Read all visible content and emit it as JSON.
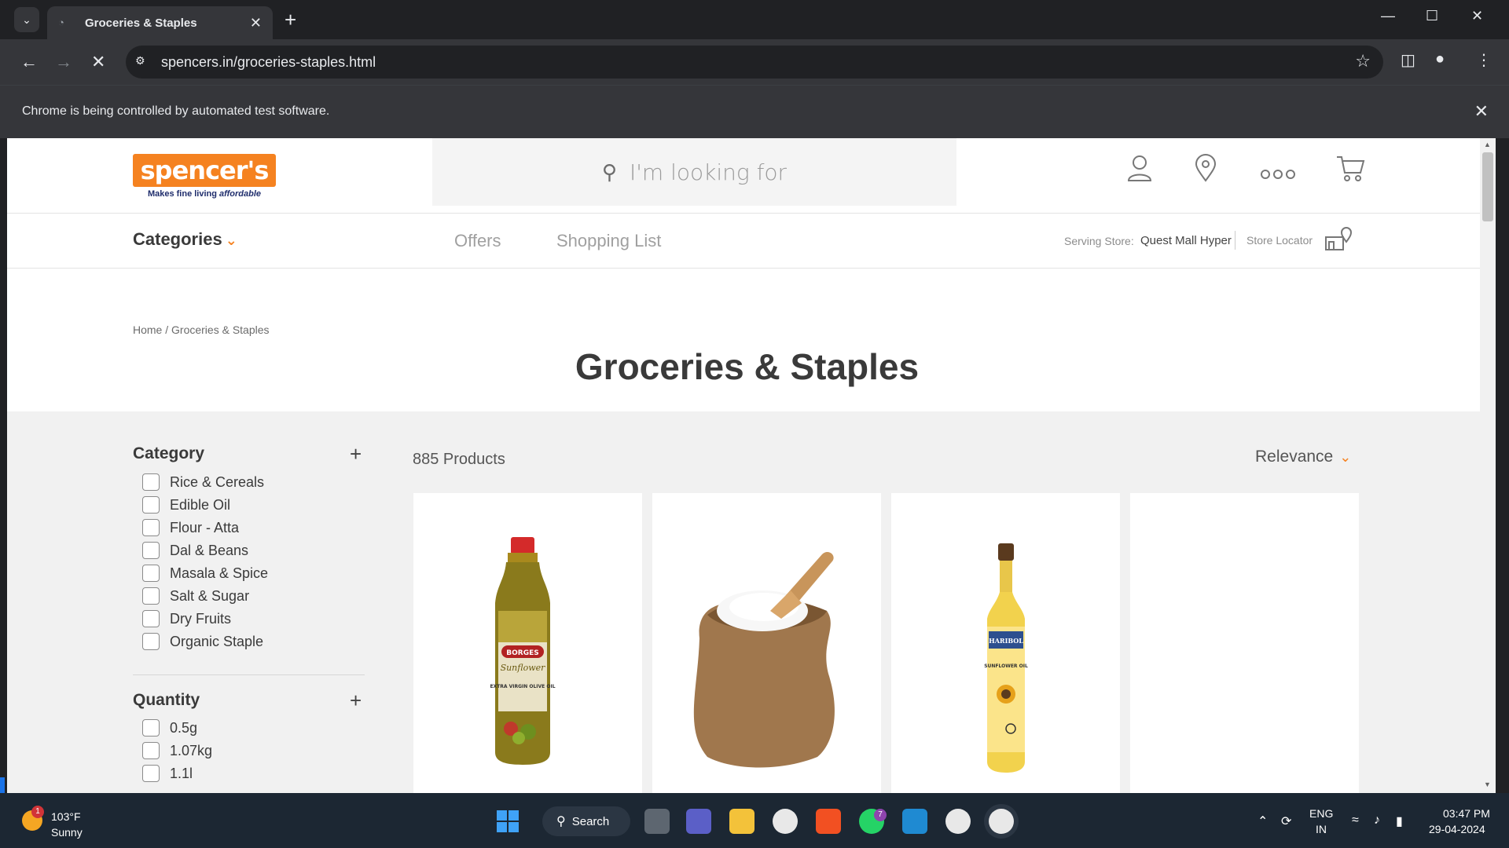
{
  "browser": {
    "tab_title": "Groceries & Staples",
    "url": "spencers.in/groceries-staples.html",
    "infobar_text": "Chrome is being controlled by automated test software."
  },
  "header": {
    "logo_word": "spencer's",
    "logo_tagline_prefix": "Makes fine living",
    "logo_tagline_emph": "affordable",
    "search_placeholder": "I'm looking for"
  },
  "nav": {
    "categories": "Categories",
    "offers": "Offers",
    "shopping_list": "Shopping List",
    "serving_label": "Serving Store:",
    "serving_store": "Quest Mall Hyper",
    "store_locator": "Store Locator"
  },
  "breadcrumb": {
    "home": "Home /",
    "current": "Groceries & Staples"
  },
  "page_title": "Groceries & Staples",
  "filters": {
    "category": {
      "title": "Category",
      "items": [
        "Rice & Cereals",
        "Edible Oil",
        "Flour - Atta",
        "Dal & Beans",
        "Masala & Spice",
        "Salt & Sugar",
        "Dry Fruits",
        "Organic Staple"
      ]
    },
    "quantity": {
      "title": "Quantity",
      "items": [
        "0.5g",
        "1.07kg",
        "1.1l"
      ]
    }
  },
  "listing": {
    "count": "885 Products",
    "sort": "Relevance",
    "product_label_1": "BORGES",
    "product_label_1b": "Sunflower",
    "product_label_1c": "EXTRA VIRGIN OLIVE OIL",
    "product_label_3": "HARIBOL",
    "product_label_3b": "SUNFLOWER OIL"
  },
  "taskbar": {
    "temp": "103°F",
    "condition": "Sunny",
    "weather_badge": "1",
    "search": "Search",
    "whatsapp_badge": "7",
    "lang1": "ENG",
    "lang2": "IN",
    "time": "03:47 PM",
    "date": "29-04-2024"
  },
  "colors": {
    "brand": "#f58220",
    "brand_navy": "#1f2d6c"
  }
}
